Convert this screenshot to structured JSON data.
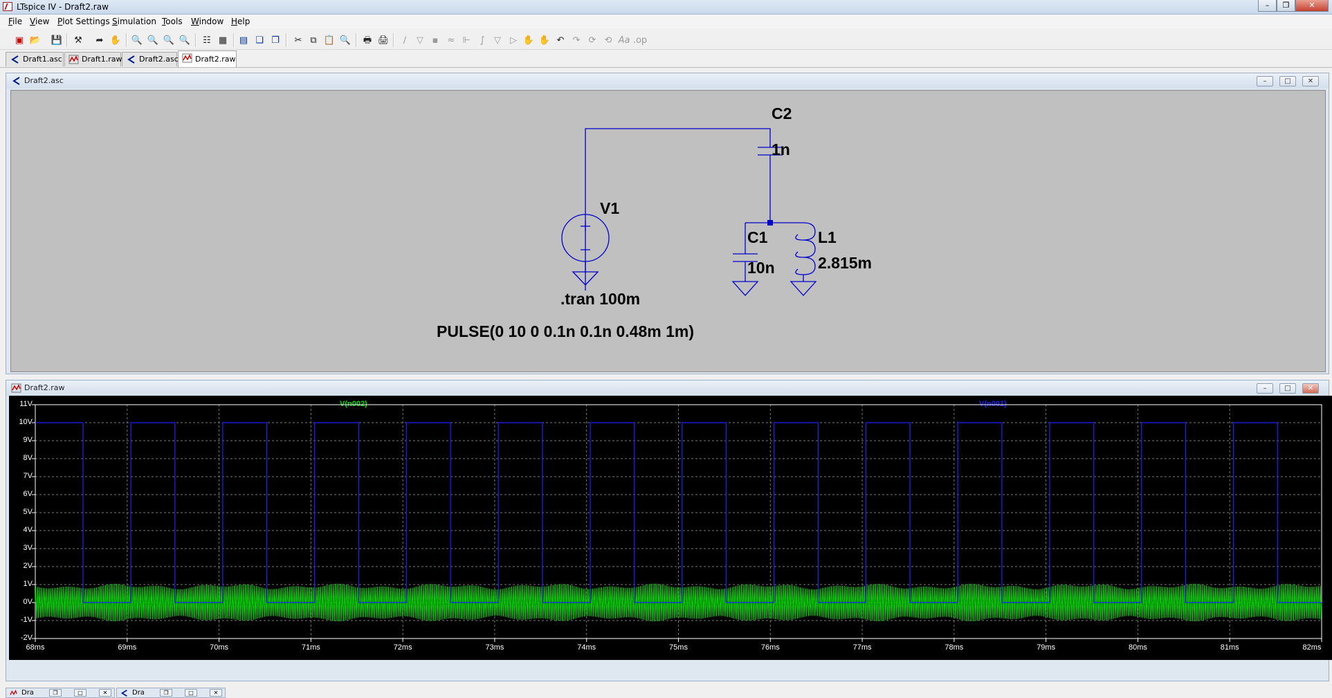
{
  "window": {
    "title": "LTspice IV - Draft2.raw"
  },
  "menu": [
    {
      "accel": "F",
      "rest": "ile"
    },
    {
      "accel": "V",
      "rest": "iew"
    },
    {
      "accel": "P",
      "rest": "lot Settings"
    },
    {
      "accel": "S",
      "rest": "imulation"
    },
    {
      "accel": "T",
      "rest": "ools"
    },
    {
      "accel": "W",
      "rest": "indow"
    },
    {
      "accel": "H",
      "rest": "elp"
    }
  ],
  "tabs": [
    {
      "label": "Draft1.asc",
      "icon": "schematic-icon"
    },
    {
      "label": "Draft1.raw",
      "icon": "waveform-icon"
    },
    {
      "label": "Draft2.asc",
      "icon": "schematic-icon"
    },
    {
      "label": "Draft2.raw",
      "icon": "waveform-icon",
      "active": true
    }
  ],
  "schematic_window": {
    "title": "Draft2.asc"
  },
  "schematic": {
    "components": {
      "C2": {
        "name": "C2",
        "value": "1n"
      },
      "V1": {
        "name": "V1"
      },
      "C1": {
        "name": "C1",
        "value": "10n"
      },
      "L1": {
        "name": "L1",
        "value": "2.815m"
      }
    },
    "directive": ".tran 100m",
    "source_value": "PULSE(0 10 0 0.1n 0.1n 0.48m 1m)",
    "wire_color": "#0000cc"
  },
  "waveform_window": {
    "title": "Draft2.raw"
  },
  "taskbar": [
    {
      "label": "Dra"
    },
    {
      "label": "Dra"
    }
  ],
  "chart_data": {
    "type": "line",
    "xlabel": "",
    "ylabel": "",
    "xlim": [
      68,
      82
    ],
    "ylim": [
      -2,
      11
    ],
    "grid": true,
    "x_ticks": [
      "68ms",
      "69ms",
      "70ms",
      "71ms",
      "72ms",
      "73ms",
      "74ms",
      "75ms",
      "76ms",
      "77ms",
      "78ms",
      "79ms",
      "80ms",
      "81ms",
      "82ms"
    ],
    "y_ticks": [
      "11V",
      "10V",
      "9V",
      "8V",
      "7V",
      "6V",
      "5V",
      "4V",
      "3V",
      "2V",
      "1V",
      "0V",
      "-1V",
      "-2V"
    ],
    "series": [
      {
        "name": "V(n001)",
        "color": "#2020ff",
        "description_type": "pulse",
        "low": 0,
        "high": 10,
        "period_ms": 1,
        "pulse_width_ms": 0.48,
        "start_ms": 68.52
      },
      {
        "name": "V(n002)",
        "color": "#00e000",
        "description_type": "oscillation",
        "center": 0,
        "amplitude": 1.05,
        "frequency_khz": 50
      }
    ]
  }
}
